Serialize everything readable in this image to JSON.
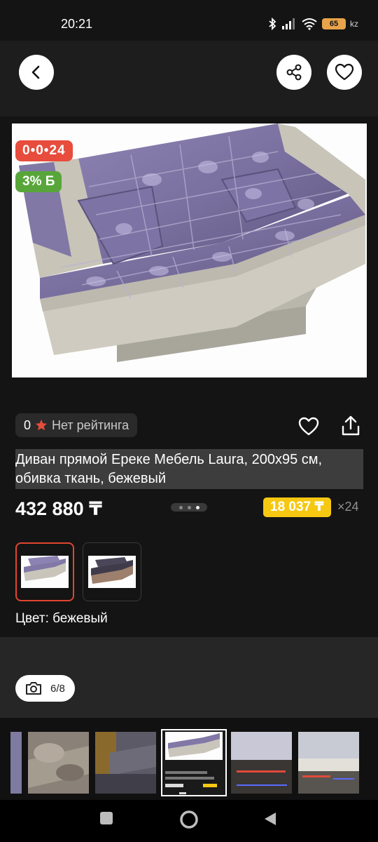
{
  "status_bar": {
    "time": "20:21",
    "battery": "65",
    "network_suffix": "kz"
  },
  "product": {
    "promo_badge": "0•0•24",
    "discount_badge": "3% Б",
    "rating_count": "0",
    "rating_text": "Нет рейтинга",
    "title": "Диван прямой Ереке Мебель Laura, 200х95 см, обивка ткань, бежевый",
    "price": "432 880 ₸",
    "installment_price": "18 037 ₸",
    "installment_months": "×24",
    "color_label": "Цвет: бежевый"
  },
  "gallery": {
    "counter": "6/8",
    "dots_total": 3,
    "dots_active": 3
  },
  "colors": {
    "accent_red": "#e74c3c",
    "accent_green": "#58a63a",
    "accent_yellow": "#f6c812",
    "selected_border": "#e0452f"
  },
  "icons": [
    "back-icon",
    "share-icon",
    "heart-icon",
    "star-icon",
    "upload-icon",
    "camera-icon",
    "nav-square-icon",
    "nav-circle-icon",
    "nav-triangle-icon"
  ]
}
